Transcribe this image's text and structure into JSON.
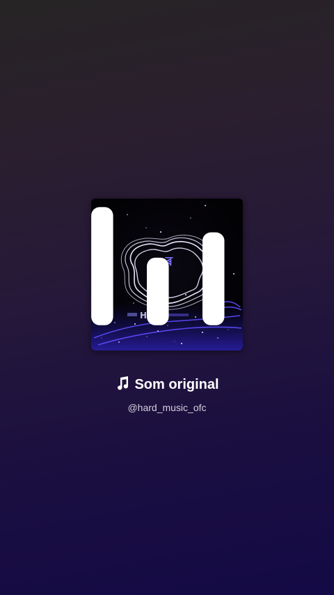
{
  "sound": {
    "title": "Som original",
    "author": "@hard_music_ofc",
    "title_icon": "music-note-icon",
    "playing_icon": "equalizer-bars-icon"
  },
  "cover_art": {
    "description_icon": "album-cover-visualizer",
    "overlay_text": "HD",
    "accent_color": "#6a4cff"
  },
  "colors": {
    "background_top": "#262424",
    "background_bottom": "#140a45",
    "text_primary": "#ffffff",
    "text_secondary": "#d4d0dc"
  }
}
